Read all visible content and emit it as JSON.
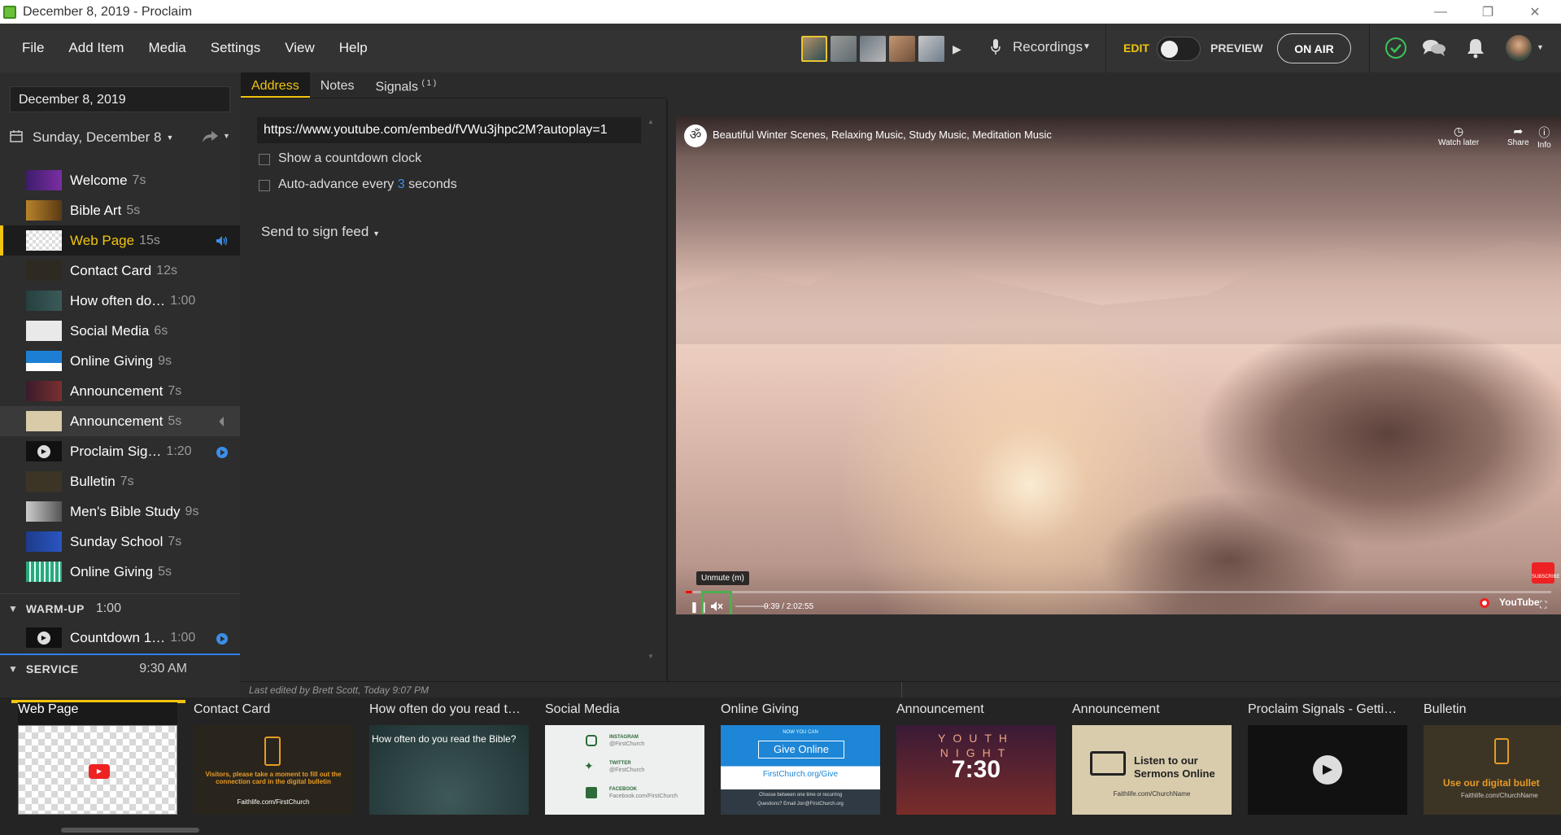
{
  "window": {
    "title": "December 8, 2019 - Proclaim"
  },
  "menu": [
    "File",
    "Add Item",
    "Media",
    "Settings",
    "View",
    "Help"
  ],
  "toolbar": {
    "recordings_label": "Recordings",
    "edit_label": "EDIT",
    "preview_label": "PREVIEW",
    "onair_label": "ON AIR"
  },
  "left": {
    "date_value": "December 8, 2019",
    "day_label": "Sunday, December 8",
    "items": [
      {
        "name": "Welcome",
        "dur": "7s"
      },
      {
        "name": "Bible Art",
        "dur": "5s"
      },
      {
        "name": "Web Page",
        "dur": "15s"
      },
      {
        "name": "Contact Card",
        "dur": "12s"
      },
      {
        "name": "How often do…",
        "dur": "1:00"
      },
      {
        "name": "Social Media",
        "dur": "6s"
      },
      {
        "name": "Online Giving",
        "dur": "9s"
      },
      {
        "name": "Announcement",
        "dur": "7s"
      },
      {
        "name": "Announcement",
        "dur": "5s"
      },
      {
        "name": "Proclaim Sig…",
        "dur": "1:20"
      },
      {
        "name": "Bulletin",
        "dur": "7s"
      },
      {
        "name": "Men's Bible Study",
        "dur": "9s"
      },
      {
        "name": "Sunday School",
        "dur": "7s"
      },
      {
        "name": "Online Giving",
        "dur": "5s"
      }
    ],
    "warmup": {
      "name": "WARM-UP",
      "dur": "1:00",
      "item_name": "Countdown 1…",
      "item_dur": "1:00"
    },
    "service": {
      "name": "SERVICE",
      "time": "9:30 AM"
    }
  },
  "center": {
    "tabs": [
      "Address",
      "Notes",
      "Signals"
    ],
    "signals_badge": "( 1 )",
    "url": "https://www.youtube.com/embed/fVWu3jhpc2M?autoplay=1",
    "countdown_label": "Show a countdown clock",
    "autoadvance_pre": "Auto-advance every ",
    "autoadvance_num": "3",
    "autoadvance_post": " seconds",
    "signfeed_label": "Send to sign feed"
  },
  "video": {
    "title": "Beautiful Winter Scenes, Relaxing Music, Study Music, Meditation Music",
    "watch_later": "Watch later",
    "share": "Share",
    "info": "Info",
    "tooltip": "Unmute (m)",
    "time": "0:39 / 2:02:55",
    "youtube": "YouTube",
    "subscribe": "SUBSCRIBE"
  },
  "status": {
    "last_edited": "Last edited by Brett Scott, Today 9:07 PM"
  },
  "filmstrip": [
    {
      "name": "Web Page"
    },
    {
      "name": "Contact Card",
      "body": "Visitors, please take a moment to fill out the connection card in the digital bulletin",
      "foot": "Faithlife.com/FirstChurch"
    },
    {
      "name": "How often do you read t…",
      "body": "How often do you read the Bible?"
    },
    {
      "name": "Social Media",
      "l1": "INSTAGRAM",
      "l1b": "@FirstChurch",
      "l2": "TWITTER",
      "l2b": "@FirstChurch",
      "l3": "FACEBOOK",
      "l3b": "Facebook.com/FirstChurch"
    },
    {
      "name": "Online Giving",
      "top": "NOW YOU CAN",
      "btn": "Give Online",
      "url": "FirstChurch.org/Give",
      "f1": "Choose between one time or recurring",
      "f2": "Questions? Email Jon@FirstChurch.org"
    },
    {
      "name": "Announcement",
      "big1": "YOUTH",
      "big2": "NIGHT",
      "time": "7:30"
    },
    {
      "name": "Announcement",
      "l1": "Listen to our",
      "l2": "Sermons Online",
      "foot": "Faithlife.com/ChurchName"
    },
    {
      "name": "Proclaim Signals - Getti…"
    },
    {
      "name": "Bulletin",
      "body": "Use our digital bullet",
      "foot": "Faithlife.com/ChurchName"
    }
  ]
}
